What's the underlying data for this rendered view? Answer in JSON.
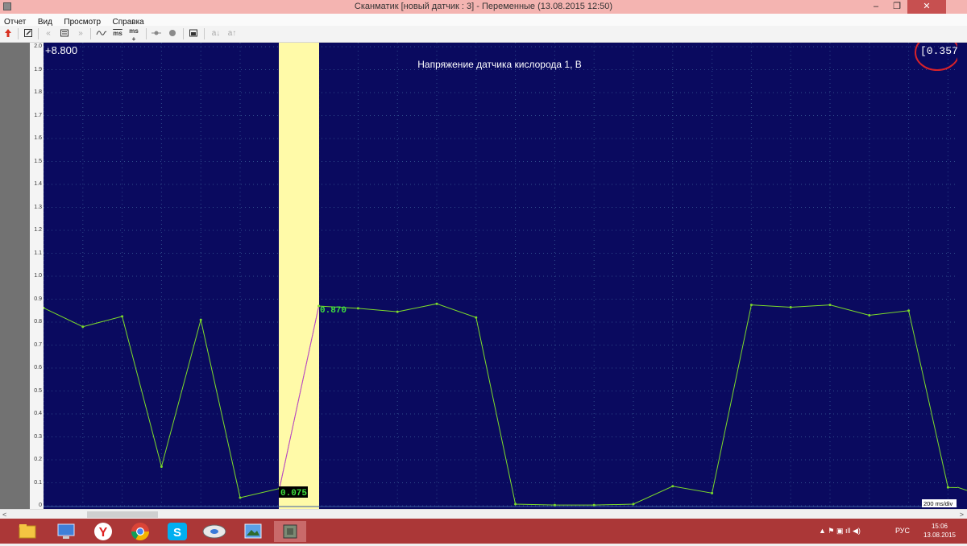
{
  "window": {
    "title": "Сканматик [новый датчик : 3] - Переменные (13.08.2015  12:50)",
    "minimize_label": "–",
    "maximize_label": "❐",
    "close_label": "✕"
  },
  "menu": [
    "Отчет",
    "Вид",
    "Просмотр",
    "Справка"
  ],
  "toolbar": {
    "ms_label": "ms",
    "ms_plus_label": "ms",
    "a_down_label": "a↓",
    "a_up_label": "a↑"
  },
  "chart": {
    "title": "Напряжение датчика кислорода 1, В",
    "offset_label": "+8.800",
    "current_value_label": "[0.357]",
    "cursor_value_low": "0.075",
    "cursor_value_high": "0.870",
    "timebase_label": "200 ms/div",
    "y_ticks": [
      "2.0",
      "1.9",
      "1.8",
      "1.7",
      "1.6",
      "1.5",
      "1.4",
      "1.3",
      "1.2",
      "1.1",
      "1.0",
      "0.9",
      "0.8",
      "0.7",
      "0.6",
      "0.5",
      "0.4",
      "0.3",
      "0.2",
      "0.1",
      "0"
    ],
    "colors": {
      "background": "#0a0a5f",
      "grid": "#2f4b8a",
      "line": "#7ddc2a",
      "cursor_band": "#fffaa8",
      "cursor_line": "#c23ad6",
      "annotation": "#d8222a"
    }
  },
  "chart_data": {
    "type": "line",
    "ylim": [
      0,
      2.0
    ],
    "series": [
      {
        "values": [
          0.862,
          0.78,
          0.825,
          0.17,
          0.81,
          0.035,
          0.075,
          0.87,
          0.86,
          0.845,
          0.88,
          0.82,
          0.007,
          0.003,
          0.003,
          0.007,
          0.085,
          0.055,
          0.875,
          0.865,
          0.875,
          0.83,
          0.85,
          0.08,
          0.075
        ]
      }
    ]
  },
  "taskbar": {
    "tray_lang": "РУС",
    "tray_icons": "▲ ⚑ ▣ ıll ◀)",
    "clock_time": "15:06",
    "clock_date": "13.08.2015"
  }
}
